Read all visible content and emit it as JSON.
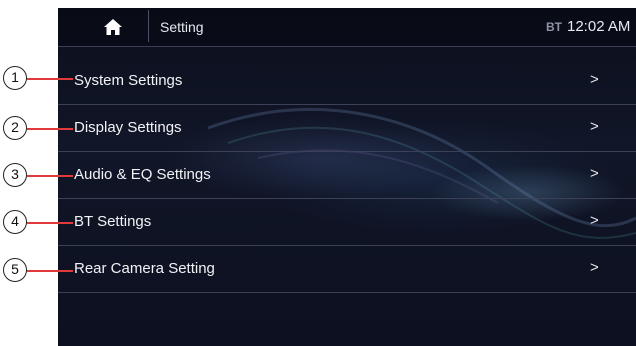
{
  "header": {
    "title": "Setting",
    "bt_label": "BT",
    "time": "12:02 AM",
    "home_icon": "home-icon"
  },
  "menu": {
    "items": [
      {
        "label": "System Settings",
        "chevron": ">",
        "callout": "1"
      },
      {
        "label": "Display Settings",
        "chevron": ">",
        "callout": "2"
      },
      {
        "label": "Audio & EQ Settings",
        "chevron": ">",
        "callout": "3"
      },
      {
        "label": "BT Settings",
        "chevron": ">",
        "callout": "4"
      },
      {
        "label": "Rear Camera Setting",
        "chevron": ">",
        "callout": "5"
      }
    ]
  },
  "colors": {
    "background": "#0e1222",
    "divider": "#3c4158",
    "text": "#f1f2f6",
    "callout_line": "#e23a3a"
  }
}
